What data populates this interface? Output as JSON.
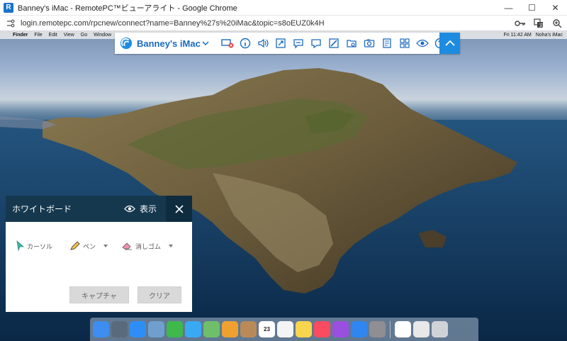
{
  "window": {
    "title": "Banney's iMac - RemotePC™ビューアライト - Google Chrome",
    "minimize_glyph": "—",
    "maximize_glyph": "☐",
    "close_glyph": "✕"
  },
  "browser": {
    "url": "login.remotepc.com/rpcnew/connect?name=Banney%27s%20iMac&topic=s8oEUZ0k4H",
    "icons": [
      "key-icon",
      "translate-icon",
      "zoom-icon"
    ]
  },
  "mac_menubar": {
    "apple": "",
    "items": [
      "Finder",
      "File",
      "Edit",
      "View",
      "Go",
      "Window"
    ],
    "clock": "Fri 11:42 AM",
    "user": "Noha's iMac"
  },
  "remotepc_toolbar": {
    "computer_name": "Banney's iMac",
    "accent_color": "#1d8ce0",
    "tools": [
      "disconnect-display-icon",
      "info-icon",
      "volume-icon",
      "fullscreen-icon",
      "chat-icon",
      "message-icon",
      "whiteboard-icon",
      "file-transfer-icon",
      "screenshot-icon",
      "notes-icon",
      "monitors-icon",
      "view-icon",
      "help-icon"
    ]
  },
  "whiteboard": {
    "title": "ホワイトボード",
    "show_label": "表示",
    "tools": {
      "cursor": "カーソル",
      "pen": "ペン",
      "eraser": "消しゴム"
    },
    "capture_button": "キャプチャ",
    "clear_button": "クリア",
    "header_color": "#16384f"
  },
  "dock": {
    "apps": [
      {
        "name": "finder-icon",
        "color": "#3d8ef0"
      },
      {
        "name": "launchpad-icon",
        "color": "#5a6a7d"
      },
      {
        "name": "safari-icon",
        "color": "#2f8ef5"
      },
      {
        "name": "preview-icon",
        "color": "#6f9fcf"
      },
      {
        "name": "facetime-icon",
        "color": "#3fb84c"
      },
      {
        "name": "messages-icon",
        "color": "#3aa9f4"
      },
      {
        "name": "maps-icon",
        "color": "#6fbf6a"
      },
      {
        "name": "photos-icon",
        "color": "#f0a030"
      },
      {
        "name": "contacts-icon",
        "color": "#b98a58"
      },
      {
        "name": "calendar-icon",
        "color": "#ffffff",
        "label": "23"
      },
      {
        "name": "reminders-icon",
        "color": "#f4f4f4"
      },
      {
        "name": "notes-icon",
        "color": "#f8d54e"
      },
      {
        "name": "music-icon",
        "color": "#fa4b60"
      },
      {
        "name": "podcasts-icon",
        "color": "#9b4fe0"
      },
      {
        "name": "app-store-icon",
        "color": "#2f86f0"
      },
      {
        "name": "system-preferences-icon",
        "color": "#8e8e93"
      },
      {
        "name": "chrome-icon",
        "color": "#ffffff"
      },
      {
        "name": "document-icon",
        "color": "#e8e8e8"
      },
      {
        "name": "trash-icon",
        "color": "#cfd3d8"
      }
    ]
  }
}
